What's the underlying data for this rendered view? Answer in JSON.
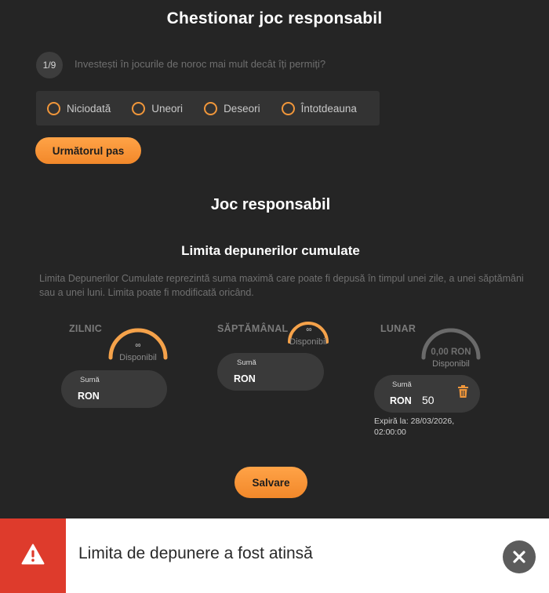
{
  "questionnaire": {
    "title": "Chestionar joc responsabil",
    "step": "1/9",
    "question": "Investești în jocurile de noroc mai mult decât îți permiți?",
    "options": [
      "Niciodată",
      "Uneori",
      "Deseori",
      "Întotdeauna"
    ],
    "next_label": "Următorul pas"
  },
  "responsible": {
    "title": "Joc responsabil",
    "subtitle": "Limita depunerilor cumulate",
    "description": "Limita Depunerilor Cumulate reprezintă suma maximă care poate fi depusă în timpul unei zile, a unei săptămâni sau a unei luni. Limita poate fi modificată oricând."
  },
  "limits": [
    {
      "period": "ZILNIC",
      "available": "∞",
      "available_label": "Disponibil",
      "amount_label": "Sumă",
      "currency": "RON",
      "value": "",
      "gauge_color": "#f5a24a",
      "fill": 1.0
    },
    {
      "period": "SĂPTĂMÂNAL",
      "available": "∞",
      "available_label": "Disponibil",
      "amount_label": "Sumă",
      "currency": "RON",
      "value": "",
      "gauge_color": "#f5a24a",
      "fill": 1.0
    },
    {
      "period": "LUNAR",
      "available": "0,00 RON",
      "available_label": "Disponibil",
      "amount_label": "Sumă",
      "currency": "RON",
      "value": "50",
      "gauge_color": "#6a6a6a",
      "fill": 0.0,
      "expires": "Expiră la: 28/03/2026, 02:00:00"
    }
  ],
  "save_label": "Salvare",
  "toast": {
    "message": "Limita de depunere a fost atinsă",
    "icon": "warning-icon",
    "close_icon": "close-icon",
    "accent_color": "#de3b2c"
  }
}
